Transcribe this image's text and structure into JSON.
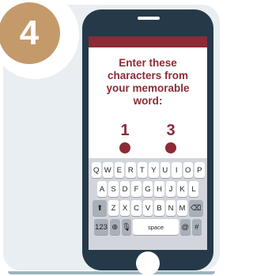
{
  "step": {
    "number": "4"
  },
  "prompt": {
    "line1": "Enter these",
    "line2": "characters from",
    "line3": "your memorable",
    "line4": "word:"
  },
  "characters": {
    "first": "1",
    "second": "3"
  },
  "keyboard": {
    "row1": [
      "Q",
      "W",
      "E",
      "R",
      "T",
      "Y",
      "U",
      "I",
      "O",
      "P"
    ],
    "row2": [
      "A",
      "S",
      "D",
      "F",
      "G",
      "H",
      "J",
      "K",
      "L"
    ],
    "row3": [
      "Z",
      "X",
      "C",
      "V",
      "B",
      "N",
      "M"
    ],
    "numbers_label": "123",
    "space_label": "space",
    "at_label": "@",
    "hash_label": "#"
  },
  "colors": {
    "accent": "#8b2b35",
    "phone_body": "#253949",
    "badge": "#c49a6b",
    "background": "#e8eef1"
  }
}
